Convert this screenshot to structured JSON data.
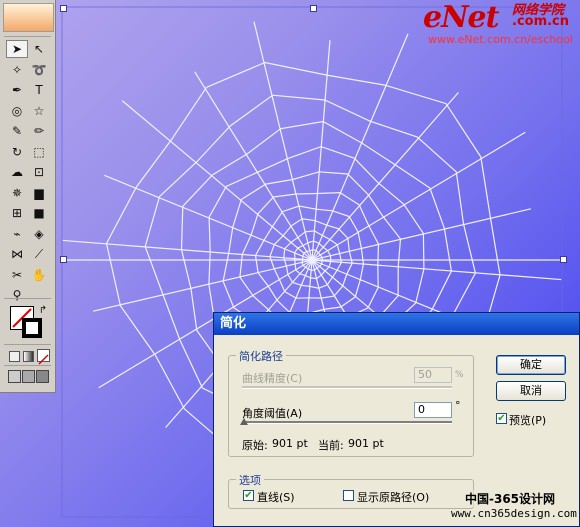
{
  "watermark": {
    "brand": "eNet",
    "brand_cn": "网络学院",
    "brand_tld": ".com.cn",
    "url": "www.eNet.com.cn/eschool",
    "site": "中国-365设计网",
    "site_url": "www.cn365design.com"
  },
  "toolbox": {
    "tools": [
      "selection-tool",
      "direct-selection-tool",
      "magic-wand-tool",
      "lasso-tool",
      "pen-tool",
      "type-tool",
      "spiral-tool",
      "star-tool",
      "paintbrush-tool",
      "pencil-tool",
      "rotate-tool",
      "scale-tool",
      "warp-tool",
      "free-transform-tool",
      "symbol-sprayer-tool",
      "column-graph-tool",
      "mesh-tool",
      "gradient-tool",
      "eyedropper-tool",
      "live-paint-tool",
      "blend-tool",
      "slice-tool",
      "scissors-tool",
      "hand-tool",
      "zoom-tool"
    ]
  },
  "dialog": {
    "title": "简化",
    "path_group": "简化路径",
    "curve_precision_label": "曲线精度(C)",
    "curve_precision_value": "50",
    "curve_precision_unit": "%",
    "angle_threshold_label": "角度阈值(A)",
    "angle_threshold_value": "0",
    "angle_unit": "°",
    "original_label": "原始:",
    "original_value": "901 pt",
    "current_label": "当前:",
    "current_value": "901 pt",
    "options_group": "选项",
    "straight_lines_label": "直线(S)",
    "straight_lines_checked": true,
    "show_original_label": "显示原路径(O)",
    "show_original_checked": false,
    "ok_label": "确定",
    "cancel_label": "取消",
    "preview_label": "预览(P)",
    "preview_checked": true
  },
  "colors": {
    "canvas_top": "#b3a6ee",
    "canvas_bottom": "#3b3bf2",
    "web_stroke": "#f0f0ff",
    "title_bar": "#0a3fc4",
    "watermark_red": "#cc0000"
  }
}
